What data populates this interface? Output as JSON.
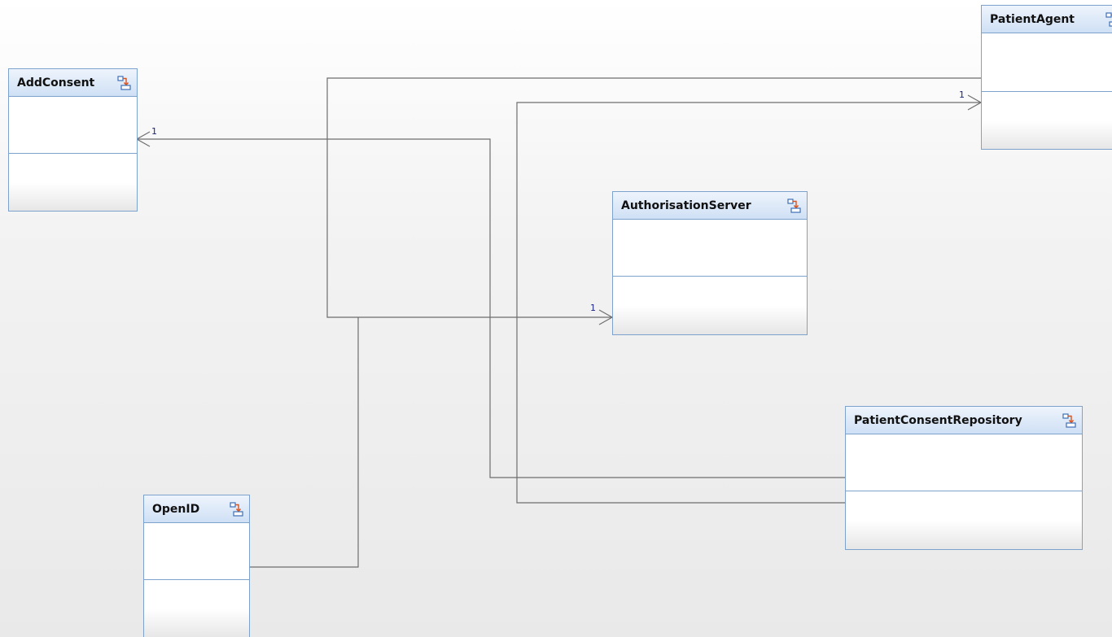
{
  "diagram": {
    "classes": [
      {
        "id": "addconsent",
        "name": "AddConsent",
        "icon": "class-icon"
      },
      {
        "id": "patientagent",
        "name": "PatientAgent",
        "icon": "class-icon"
      },
      {
        "id": "authorisationserver",
        "name": "AuthorisationServer",
        "icon": "class-icon"
      },
      {
        "id": "patientconsentrepository",
        "name": "PatientConsentRepository",
        "icon": "class-icon"
      },
      {
        "id": "openid",
        "name": "OpenID",
        "icon": "class-icon"
      }
    ],
    "multiplicities": {
      "addconsent_end": "1",
      "patientagent_end": "1",
      "authorisationserver_end": "1"
    }
  },
  "colors": {
    "border": "#7da2ce",
    "connector": "#6e6e6e",
    "multiplicity_text": "#1a237e",
    "icon_orange": "#d9531e",
    "icon_blue": "#3d6fb5"
  }
}
